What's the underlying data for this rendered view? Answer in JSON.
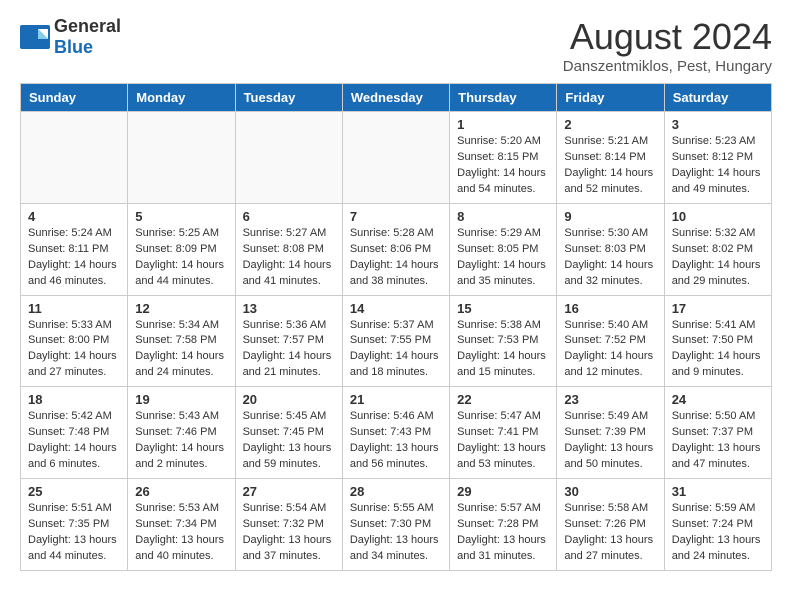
{
  "header": {
    "logo_general": "General",
    "logo_blue": "Blue",
    "title": "August 2024",
    "location": "Danszentmiklos, Pest, Hungary"
  },
  "weekdays": [
    "Sunday",
    "Monday",
    "Tuesday",
    "Wednesday",
    "Thursday",
    "Friday",
    "Saturday"
  ],
  "weeks": [
    [
      {
        "day": "",
        "empty": true
      },
      {
        "day": "",
        "empty": true
      },
      {
        "day": "",
        "empty": true
      },
      {
        "day": "",
        "empty": true
      },
      {
        "day": "1",
        "sunrise": "5:20 AM",
        "sunset": "8:15 PM",
        "daylight": "14 hours and 54 minutes."
      },
      {
        "day": "2",
        "sunrise": "5:21 AM",
        "sunset": "8:14 PM",
        "daylight": "14 hours and 52 minutes."
      },
      {
        "day": "3",
        "sunrise": "5:23 AM",
        "sunset": "8:12 PM",
        "daylight": "14 hours and 49 minutes."
      }
    ],
    [
      {
        "day": "4",
        "sunrise": "5:24 AM",
        "sunset": "8:11 PM",
        "daylight": "14 hours and 46 minutes."
      },
      {
        "day": "5",
        "sunrise": "5:25 AM",
        "sunset": "8:09 PM",
        "daylight": "14 hours and 44 minutes."
      },
      {
        "day": "6",
        "sunrise": "5:27 AM",
        "sunset": "8:08 PM",
        "daylight": "14 hours and 41 minutes."
      },
      {
        "day": "7",
        "sunrise": "5:28 AM",
        "sunset": "8:06 PM",
        "daylight": "14 hours and 38 minutes."
      },
      {
        "day": "8",
        "sunrise": "5:29 AM",
        "sunset": "8:05 PM",
        "daylight": "14 hours and 35 minutes."
      },
      {
        "day": "9",
        "sunrise": "5:30 AM",
        "sunset": "8:03 PM",
        "daylight": "14 hours and 32 minutes."
      },
      {
        "day": "10",
        "sunrise": "5:32 AM",
        "sunset": "8:02 PM",
        "daylight": "14 hours and 29 minutes."
      }
    ],
    [
      {
        "day": "11",
        "sunrise": "5:33 AM",
        "sunset": "8:00 PM",
        "daylight": "14 hours and 27 minutes."
      },
      {
        "day": "12",
        "sunrise": "5:34 AM",
        "sunset": "7:58 PM",
        "daylight": "14 hours and 24 minutes."
      },
      {
        "day": "13",
        "sunrise": "5:36 AM",
        "sunset": "7:57 PM",
        "daylight": "14 hours and 21 minutes."
      },
      {
        "day": "14",
        "sunrise": "5:37 AM",
        "sunset": "7:55 PM",
        "daylight": "14 hours and 18 minutes."
      },
      {
        "day": "15",
        "sunrise": "5:38 AM",
        "sunset": "7:53 PM",
        "daylight": "14 hours and 15 minutes."
      },
      {
        "day": "16",
        "sunrise": "5:40 AM",
        "sunset": "7:52 PM",
        "daylight": "14 hours and 12 minutes."
      },
      {
        "day": "17",
        "sunrise": "5:41 AM",
        "sunset": "7:50 PM",
        "daylight": "14 hours and 9 minutes."
      }
    ],
    [
      {
        "day": "18",
        "sunrise": "5:42 AM",
        "sunset": "7:48 PM",
        "daylight": "14 hours and 6 minutes."
      },
      {
        "day": "19",
        "sunrise": "5:43 AM",
        "sunset": "7:46 PM",
        "daylight": "14 hours and 2 minutes."
      },
      {
        "day": "20",
        "sunrise": "5:45 AM",
        "sunset": "7:45 PM",
        "daylight": "13 hours and 59 minutes."
      },
      {
        "day": "21",
        "sunrise": "5:46 AM",
        "sunset": "7:43 PM",
        "daylight": "13 hours and 56 minutes."
      },
      {
        "day": "22",
        "sunrise": "5:47 AM",
        "sunset": "7:41 PM",
        "daylight": "13 hours and 53 minutes."
      },
      {
        "day": "23",
        "sunrise": "5:49 AM",
        "sunset": "7:39 PM",
        "daylight": "13 hours and 50 minutes."
      },
      {
        "day": "24",
        "sunrise": "5:50 AM",
        "sunset": "7:37 PM",
        "daylight": "13 hours and 47 minutes."
      }
    ],
    [
      {
        "day": "25",
        "sunrise": "5:51 AM",
        "sunset": "7:35 PM",
        "daylight": "13 hours and 44 minutes."
      },
      {
        "day": "26",
        "sunrise": "5:53 AM",
        "sunset": "7:34 PM",
        "daylight": "13 hours and 40 minutes."
      },
      {
        "day": "27",
        "sunrise": "5:54 AM",
        "sunset": "7:32 PM",
        "daylight": "13 hours and 37 minutes."
      },
      {
        "day": "28",
        "sunrise": "5:55 AM",
        "sunset": "7:30 PM",
        "daylight": "13 hours and 34 minutes."
      },
      {
        "day": "29",
        "sunrise": "5:57 AM",
        "sunset": "7:28 PM",
        "daylight": "13 hours and 31 minutes."
      },
      {
        "day": "30",
        "sunrise": "5:58 AM",
        "sunset": "7:26 PM",
        "daylight": "13 hours and 27 minutes."
      },
      {
        "day": "31",
        "sunrise": "5:59 AM",
        "sunset": "7:24 PM",
        "daylight": "13 hours and 24 minutes."
      }
    ]
  ],
  "labels": {
    "sunrise": "Sunrise:",
    "sunset": "Sunset:",
    "daylight": "Daylight:"
  }
}
